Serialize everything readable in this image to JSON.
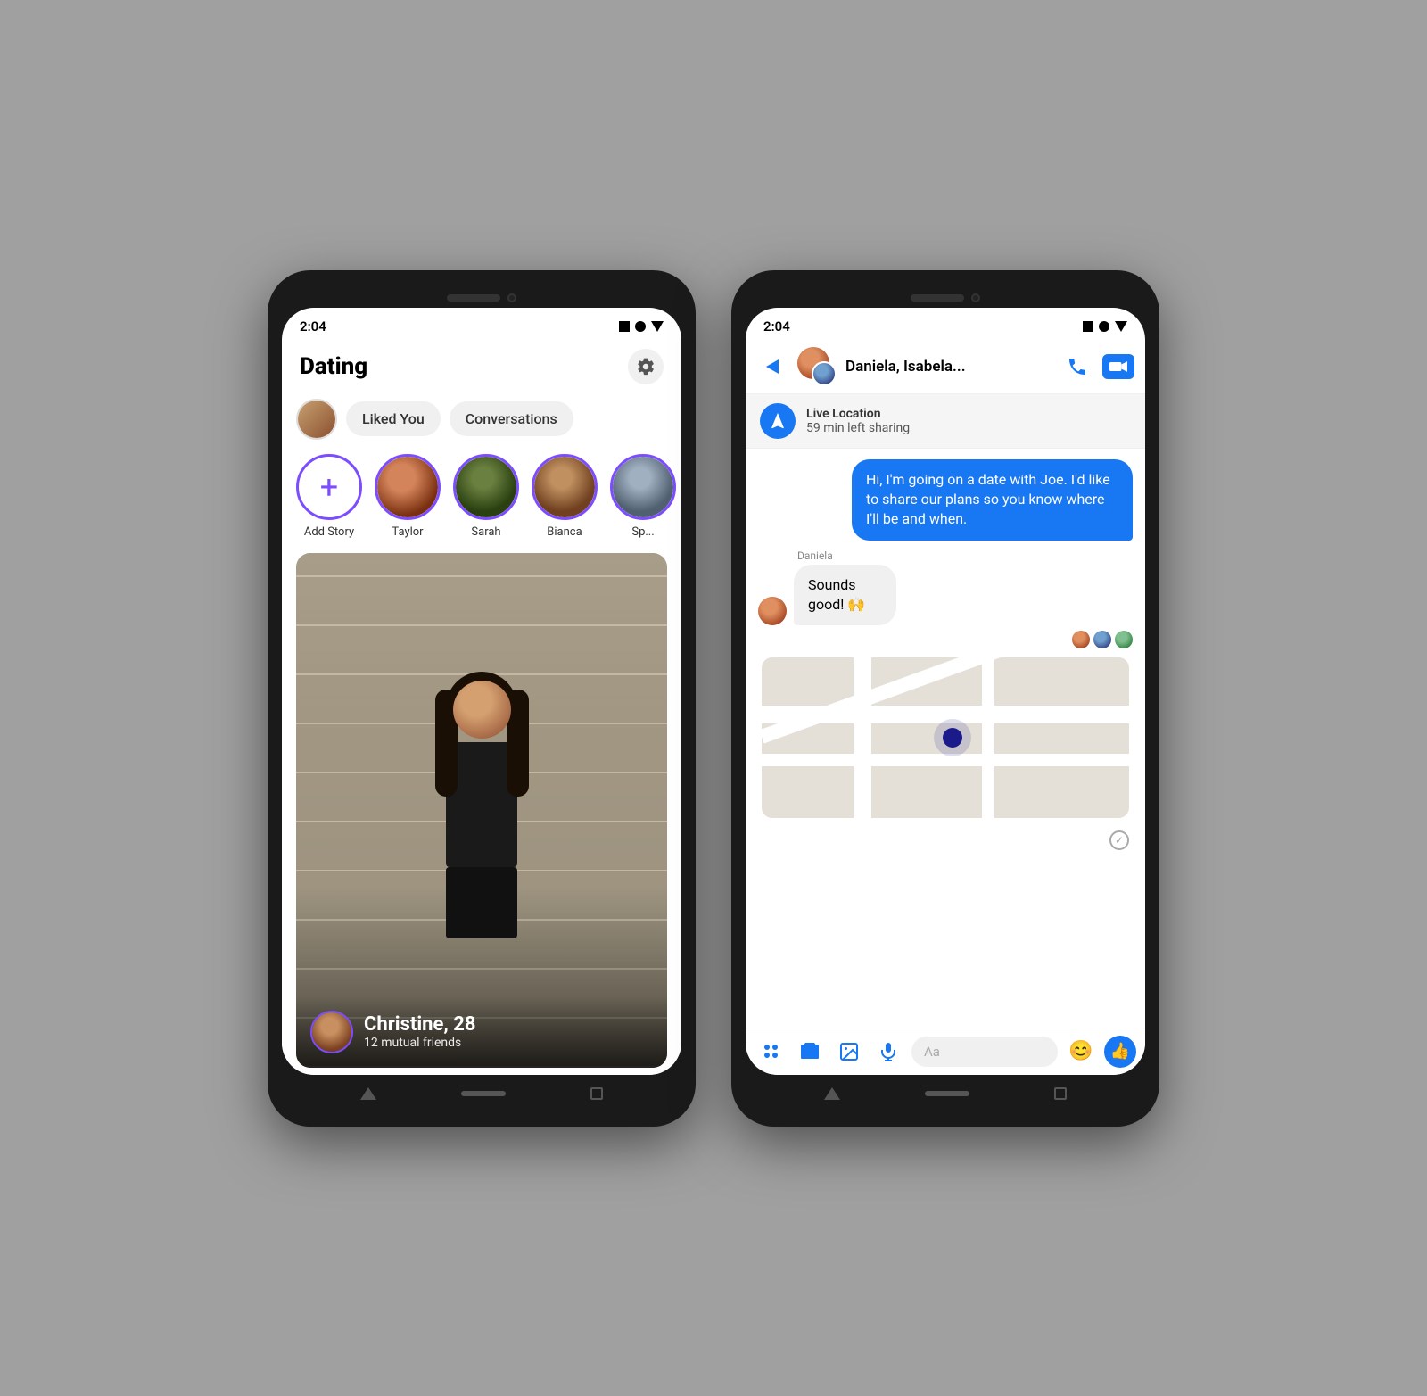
{
  "left_phone": {
    "status_time": "2:04",
    "app_title": "Dating",
    "gear_label": "Settings",
    "filter_tabs": [
      {
        "id": "liked_you",
        "label": "Liked You"
      },
      {
        "id": "conversations",
        "label": "Conversations"
      }
    ],
    "stories": [
      {
        "id": "add_story",
        "label": "Add Story",
        "type": "add"
      },
      {
        "id": "taylor",
        "label": "Taylor",
        "type": "person"
      },
      {
        "id": "sarah",
        "label": "Sarah",
        "type": "person"
      },
      {
        "id": "bianca",
        "label": "Bianca",
        "type": "person"
      },
      {
        "id": "sp",
        "label": "Sp...",
        "type": "person"
      }
    ],
    "profile_card": {
      "name": "Christine, 28",
      "mutual": "12 mutual friends"
    }
  },
  "right_phone": {
    "status_time": "2:04",
    "chat_name": "Daniela, Isabela...",
    "location_banner": {
      "title": "Live Location",
      "subtitle": "59 min left sharing"
    },
    "messages": [
      {
        "id": "msg1",
        "type": "outgoing",
        "text": "Hi, I'm going on a date with Joe. I'd like to share our plans so you know where I'll be and when."
      },
      {
        "id": "msg2",
        "type": "incoming",
        "sender": "Daniela",
        "text": "Sounds good! 🙌"
      }
    ],
    "input_placeholder": "Aa",
    "back_label": "Back",
    "call_label": "Call",
    "video_label": "Video Call"
  }
}
